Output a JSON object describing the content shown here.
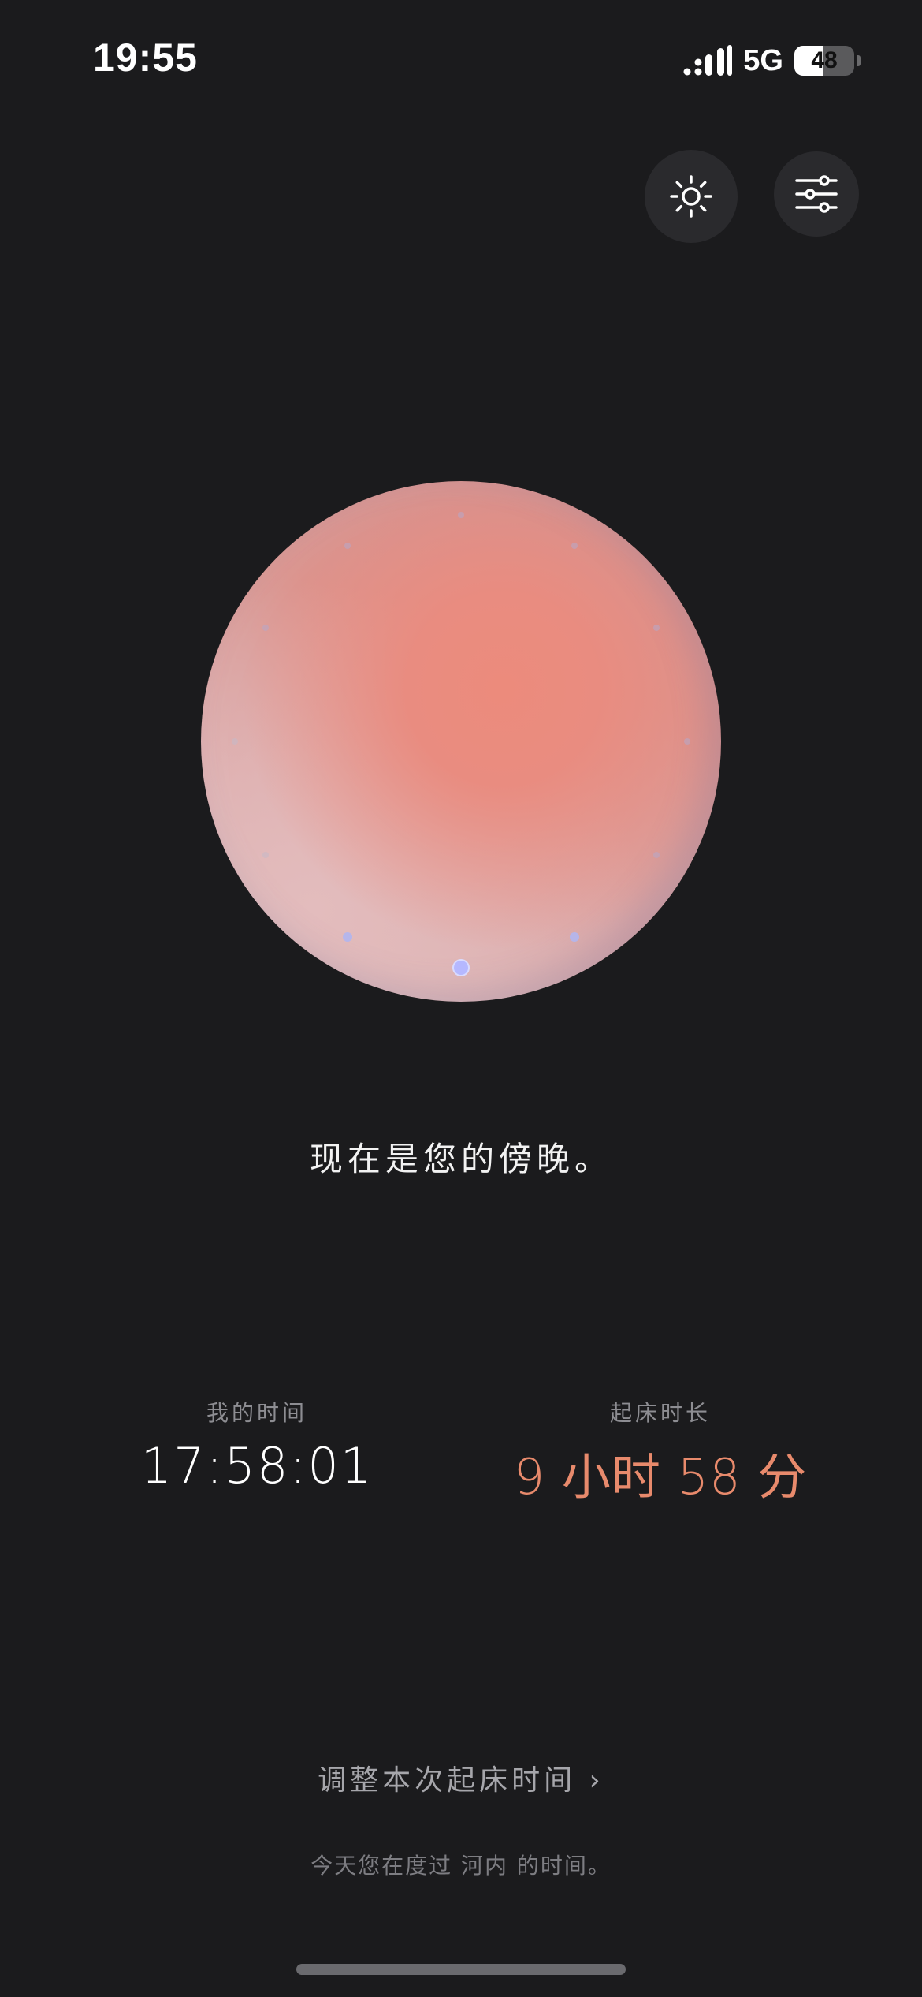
{
  "status_bar": {
    "time": "19:55",
    "network": "5G",
    "battery": "48",
    "battery_level": 0.48
  },
  "header": {
    "brightness_icon": "sun-icon",
    "settings_icon": "sliders-icon"
  },
  "main": {
    "period_text": "现在是您的傍晚。",
    "my_time_label": "我的时间",
    "my_time_value": "17:58:01",
    "wake_duration_label": "起床时长",
    "wake_duration_value": "9 小时 58 分"
  },
  "footer": {
    "adjust_link": "调整本次起床时间 ›",
    "location_line": "今天您在度过 河内 的时间。"
  },
  "colors": {
    "background": "#1b1b1d",
    "accent": "#e88a6c",
    "orb_core": "#ec8b7c",
    "marker": "#b5b8ff"
  }
}
